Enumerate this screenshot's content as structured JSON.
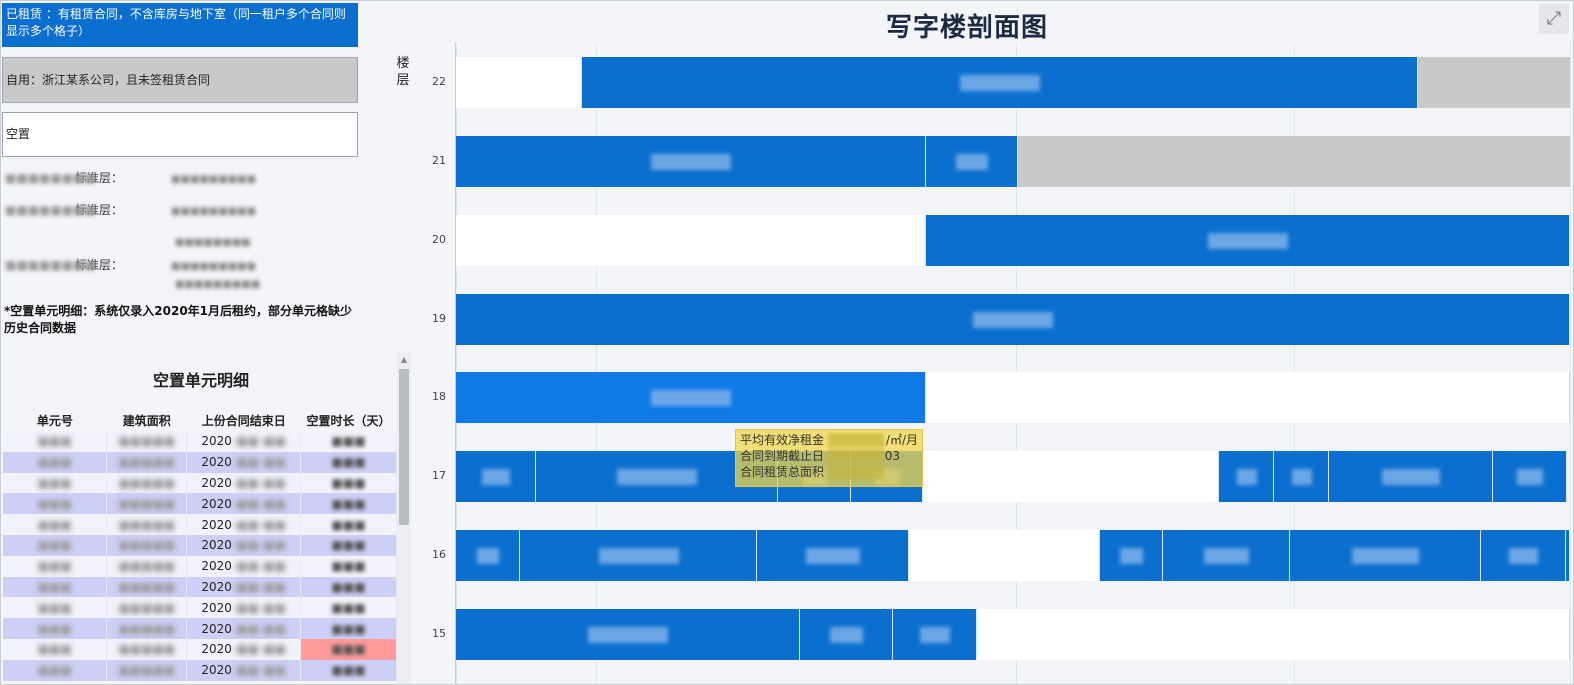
{
  "legend": {
    "leased": "已租赁 ：有租赁合同，不含库房与地下室（同一租户多个合同则显示多个格子）",
    "self_use": "自用：浙江某系公司，且未签租赁合同",
    "vacant": "空置"
  },
  "standard_floors": [
    {
      "label": "标准层："
    },
    {
      "label": "标准层："
    },
    {
      "label": "标准层："
    }
  ],
  "note": "*空置单元明细：系统仅录入2020年1月后租约，部分单元格缺少历史合同数据",
  "vacant_table": {
    "title": "空置单元明细",
    "columns": [
      "单元号",
      "建筑面积",
      "上份合同结束日",
      "空置时长（天）"
    ],
    "row_date_prefix": "2020",
    "rows": 12
  },
  "chart": {
    "title": "写字楼剖面图",
    "floor_axis_label": "楼层",
    "expand_icon": "expand-icon"
  },
  "chart_data": {
    "type": "bar",
    "orientation": "horizontal-stacked",
    "categories": [
      "22",
      "21",
      "20",
      "19",
      "18",
      "17",
      "16",
      "15"
    ],
    "floors": [
      {
        "floor": "22",
        "units": [
          "vacant",
          "leased",
          "self"
        ]
      },
      {
        "floor": "21",
        "units": [
          "leased",
          "leased",
          "self"
        ]
      },
      {
        "floor": "20",
        "units": [
          "vacant",
          "leased"
        ]
      },
      {
        "floor": "19",
        "units": [
          "leased"
        ]
      },
      {
        "floor": "18",
        "units": [
          "leased",
          "vacant"
        ]
      },
      {
        "floor": "17",
        "units": [
          "leased",
          "leased",
          "leased",
          "leased",
          "vacant",
          "leased",
          "leased",
          "leased",
          "leased"
        ]
      },
      {
        "floor": "16",
        "units": [
          "leased",
          "leased",
          "leased",
          "vacant",
          "leased",
          "leased",
          "leased",
          "leased",
          "leased"
        ]
      },
      {
        "floor": "15",
        "units": [
          "leased",
          "leased",
          "leased",
          "vacant"
        ]
      }
    ],
    "colors": {
      "leased": "#0b6fcf",
      "self": "#c9c9c9",
      "vacant": "#ffffff"
    }
  },
  "tooltip": {
    "line1": "平均有效净租金",
    "line1_unit": "/㎡/月",
    "line2": "合同到期截止日",
    "line2_value": "03",
    "line3": "合同租赁总面积"
  }
}
